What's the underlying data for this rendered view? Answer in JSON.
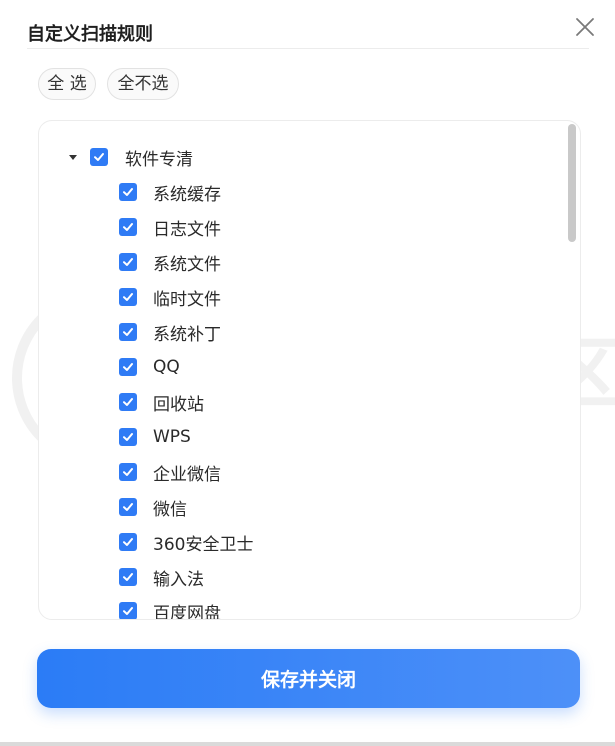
{
  "dialog": {
    "title": "自定义扫描规则",
    "close_icon": "close-icon"
  },
  "actions": {
    "select_all": "全 选",
    "select_none": "全不选",
    "save": "保存并关闭"
  },
  "tree": {
    "root": {
      "label": "软件专清",
      "checked": true,
      "expanded": true
    },
    "items": [
      {
        "label": "系统缓存",
        "checked": true
      },
      {
        "label": "日志文件",
        "checked": true
      },
      {
        "label": "系统文件",
        "checked": true
      },
      {
        "label": "临时文件",
        "checked": true
      },
      {
        "label": "系统补丁",
        "checked": true
      },
      {
        "label": "QQ",
        "checked": true
      },
      {
        "label": "回收站",
        "checked": true
      },
      {
        "label": "WPS",
        "checked": true
      },
      {
        "label": "企业微信",
        "checked": true
      },
      {
        "label": "微信",
        "checked": true
      },
      {
        "label": "360安全卫士",
        "checked": true
      },
      {
        "label": "输入法",
        "checked": true
      },
      {
        "label": "百度网盘",
        "checked": true
      }
    ]
  },
  "watermark": {
    "name": "i3综合社区",
    "url": "www.i3zh.com"
  },
  "colors": {
    "accent": "#2f7bf5",
    "button_start": "#2b7cf6",
    "button_end": "#4d90f8"
  }
}
